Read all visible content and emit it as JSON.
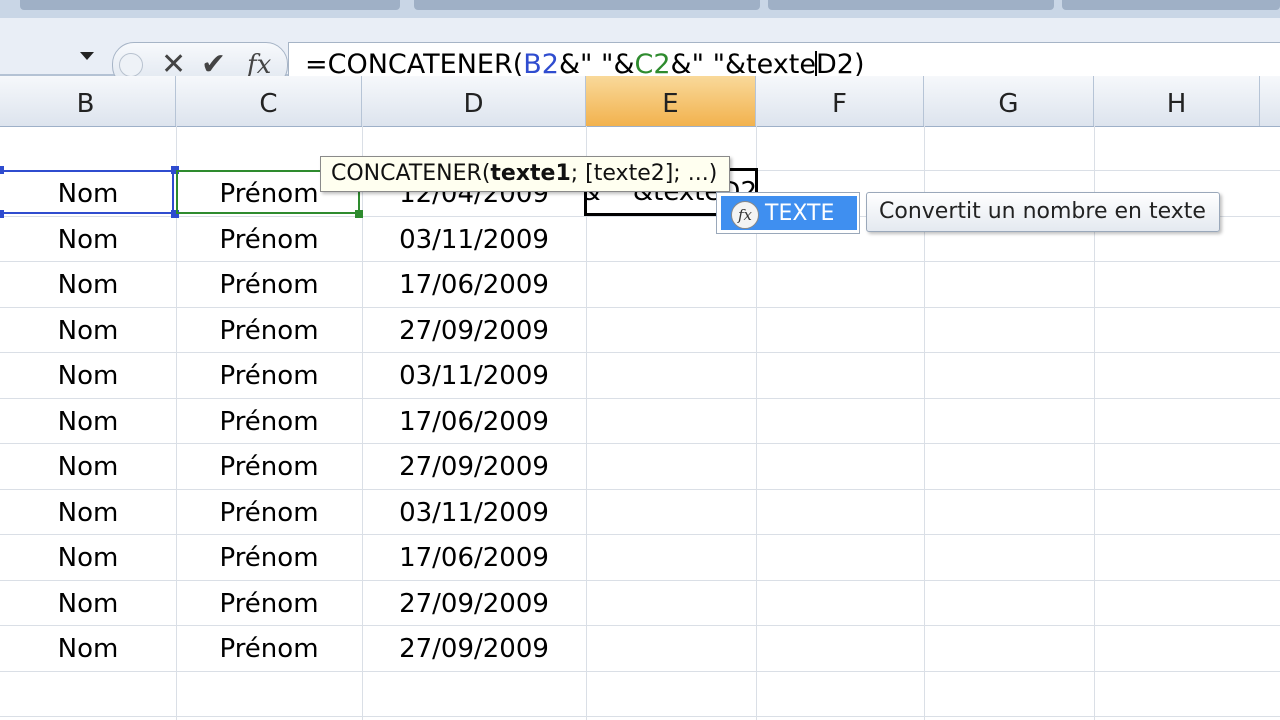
{
  "formula_bar": {
    "prefix": "=CONCATENER(",
    "ref_b": "B2",
    "mid1": "&\" \"&",
    "ref_c": "C2",
    "mid2": "&\" \"&texte",
    "after_caret": "D2)"
  },
  "columns": [
    "B",
    "C",
    "D",
    "E",
    "F",
    "G",
    "H"
  ],
  "active_column": "E",
  "rows": [
    {
      "nom": "Nom",
      "prenom": "Prénom",
      "date": "12/04/2009"
    },
    {
      "nom": "Nom",
      "prenom": "Prénom",
      "date": "03/11/2009"
    },
    {
      "nom": "Nom",
      "prenom": "Prénom",
      "date": "17/06/2009"
    },
    {
      "nom": "Nom",
      "prenom": "Prénom",
      "date": "27/09/2009"
    },
    {
      "nom": "Nom",
      "prenom": "Prénom",
      "date": "03/11/2009"
    },
    {
      "nom": "Nom",
      "prenom": "Prénom",
      "date": "17/06/2009"
    },
    {
      "nom": "Nom",
      "prenom": "Prénom",
      "date": "27/09/2009"
    },
    {
      "nom": "Nom",
      "prenom": "Prénom",
      "date": "03/11/2009"
    },
    {
      "nom": "Nom",
      "prenom": "Prénom",
      "date": "17/06/2009"
    },
    {
      "nom": "Nom",
      "prenom": "Prénom",
      "date": "27/09/2009"
    },
    {
      "nom": "Nom",
      "prenom": "Prénom",
      "date": "27/09/2009"
    }
  ],
  "active_cell_text": "&\" \"&texteD2",
  "argument_tooltip": {
    "func": "CONCATENER(",
    "arg_bold": "texte1",
    "rest": "; [texte2]; ...)"
  },
  "autocomplete": {
    "icon": "function-icon",
    "item": "TEXTE",
    "description": "Convertit un nombre en texte"
  },
  "colors": {
    "ref_b": "#2f4ccf",
    "ref_c": "#2e8b2e",
    "highlight": "#3f8ff0",
    "header_active": "#f2b24e"
  }
}
